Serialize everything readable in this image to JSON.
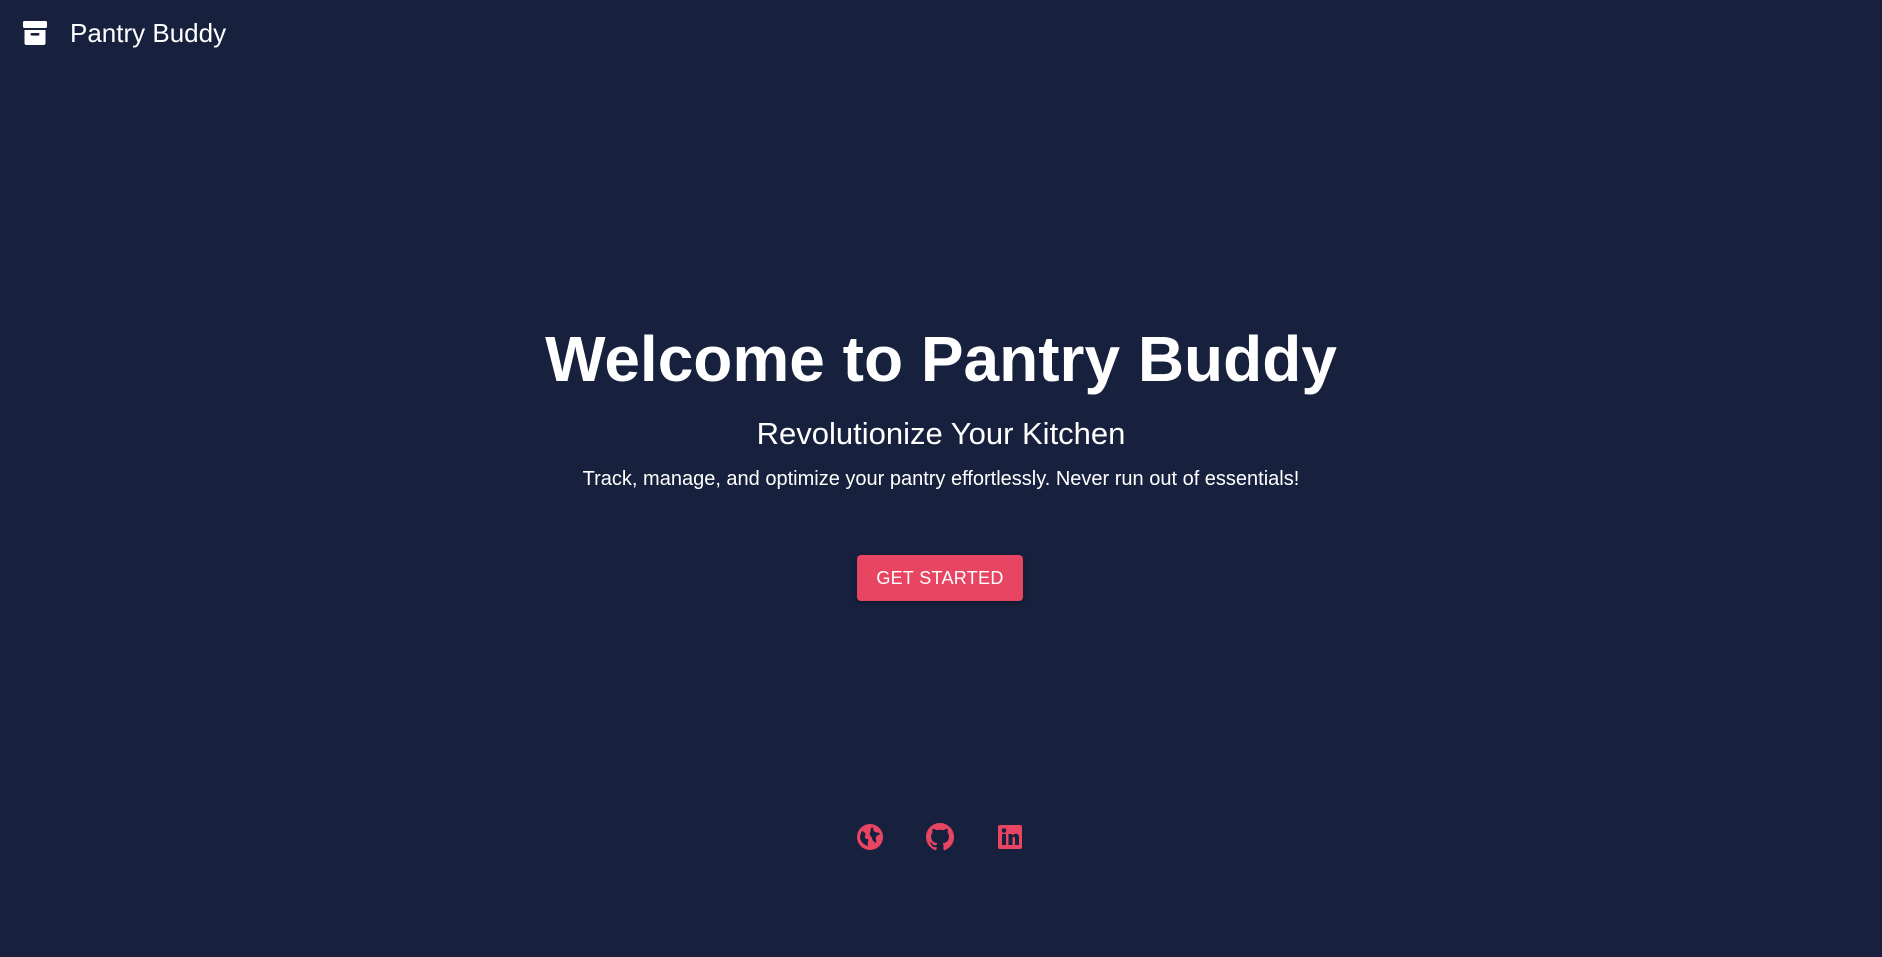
{
  "header": {
    "brand_name": "Pantry Buddy",
    "brand_icon": "archive-box-icon"
  },
  "hero": {
    "title": "Welcome to Pantry Buddy",
    "subtitle": "Revolutionize Your Kitchen",
    "description": "Track, manage, and optimize your pantry effortlessly. Never run out of essentials!",
    "cta_label": "GET STARTED"
  },
  "social_links": [
    {
      "icon": "globe-icon"
    },
    {
      "icon": "github-icon"
    },
    {
      "icon": "linkedin-icon"
    }
  ],
  "colors": {
    "background": "#17203d",
    "accent": "#e84563",
    "text": "#ffffff"
  }
}
